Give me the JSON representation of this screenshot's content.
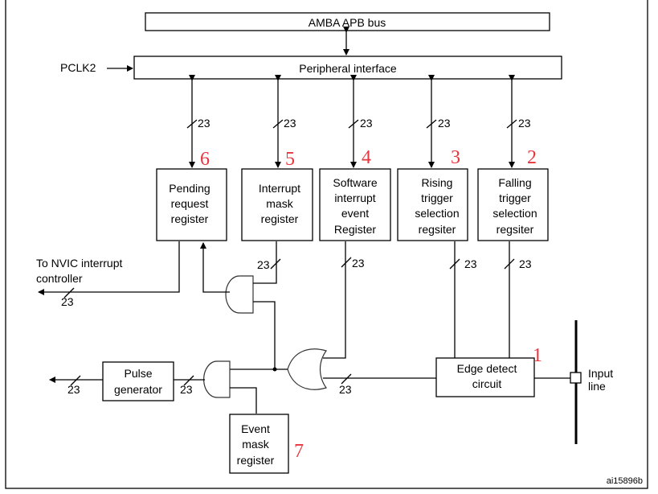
{
  "diagram": {
    "bus": "AMBA APB bus",
    "peripheral_interface": "Peripheral interface",
    "clock": "PCLK2",
    "bus_width": "23",
    "registers": [
      {
        "id": "pending",
        "lines": [
          "Pending",
          "request",
          "register"
        ],
        "number": "6"
      },
      {
        "id": "interrupt-mask",
        "lines": [
          "Interrupt",
          "mask",
          "register"
        ],
        "number": "5"
      },
      {
        "id": "software-interrupt",
        "lines": [
          "Software",
          "interrupt",
          "event",
          "Register"
        ],
        "number": "4"
      },
      {
        "id": "rising-trigger",
        "lines": [
          "Rising",
          "trigger",
          "selection",
          "regsiter"
        ],
        "number": "3"
      },
      {
        "id": "falling-trigger",
        "lines": [
          "Falling",
          "trigger",
          "selection",
          "regsiter"
        ],
        "number": "2"
      }
    ],
    "edge_detect": {
      "lines": [
        "Edge detect",
        "circuit"
      ],
      "number": "1"
    },
    "event_mask": {
      "lines": [
        "Event",
        "mask",
        "register"
      ],
      "number": "7"
    },
    "pulse_generator": {
      "lines": [
        "Pulse",
        "generator"
      ]
    },
    "nvic": {
      "lines": [
        "To NVIC interrupt",
        "controller"
      ]
    },
    "input_line": {
      "lines": [
        "Input",
        "line"
      ]
    },
    "figure_id": "ai15896b"
  }
}
